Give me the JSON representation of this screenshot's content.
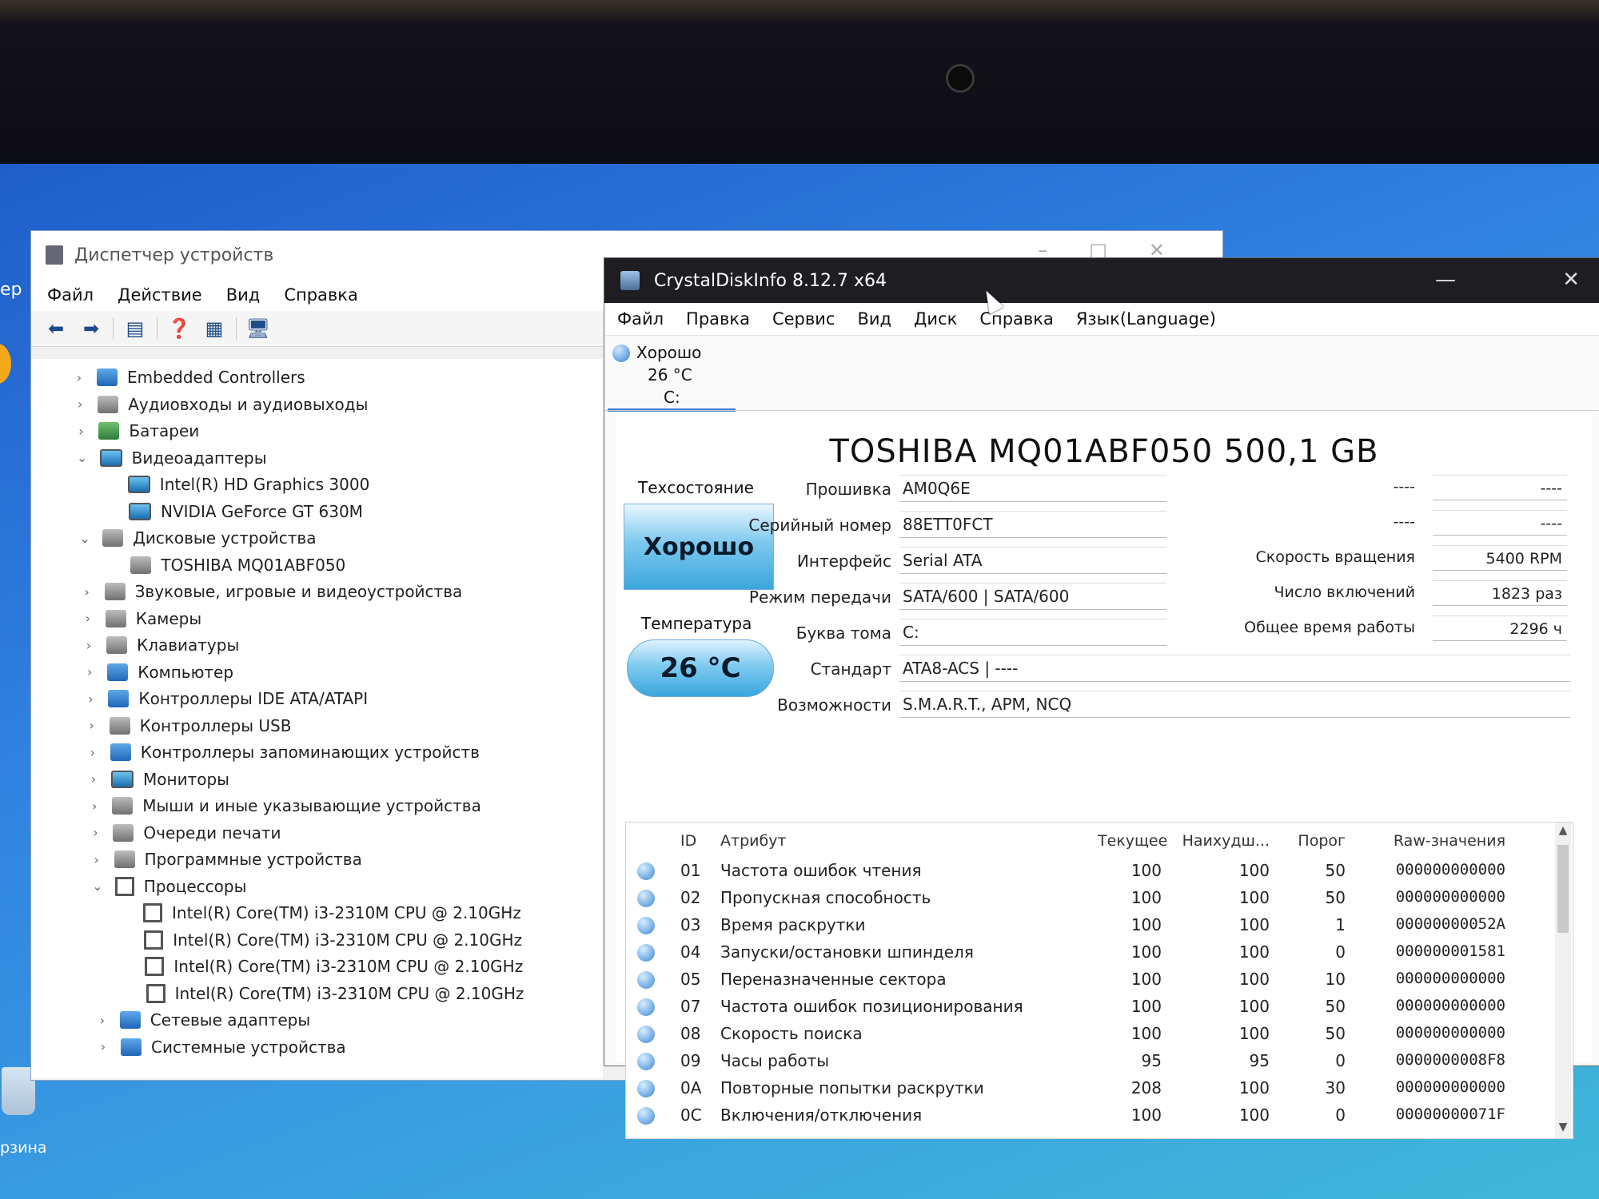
{
  "desktop": {
    "left_text": "ер",
    "recycle_label": "рзина"
  },
  "device_manager": {
    "title": "Диспетчер устройств",
    "menu": [
      "Файл",
      "Действие",
      "Вид",
      "Справка"
    ],
    "toolbar_icons": [
      "back-icon",
      "forward-icon",
      "properties-icon",
      "help-icon",
      "view-icon",
      "monitor-icon"
    ],
    "tree": [
      {
        "label": "Embedded Controllers",
        "level": 0,
        "expanded": false,
        "icon": "controller-icon"
      },
      {
        "label": "Аудиовходы и аудиовыходы",
        "level": 0,
        "expanded": false,
        "icon": "speaker-icon"
      },
      {
        "label": "Батареи",
        "level": 0,
        "expanded": false,
        "icon": "battery-icon"
      },
      {
        "label": "Видеоадаптеры",
        "level": 0,
        "expanded": true,
        "icon": "display-adapter-icon"
      },
      {
        "label": "Intel(R) HD Graphics 3000",
        "level": 1,
        "icon": "display-adapter-icon"
      },
      {
        "label": "NVIDIA GeForce GT 630M",
        "level": 1,
        "icon": "display-adapter-icon"
      },
      {
        "label": "Дисковые устройства",
        "level": 0,
        "expanded": true,
        "icon": "disk-icon"
      },
      {
        "label": "TOSHIBA MQ01ABF050",
        "level": 1,
        "icon": "disk-icon"
      },
      {
        "label": "Звуковые, игровые и видеоустройства",
        "level": 0,
        "expanded": false,
        "icon": "speaker-icon"
      },
      {
        "label": "Камеры",
        "level": 0,
        "expanded": false,
        "icon": "camera-icon"
      },
      {
        "label": "Клавиатуры",
        "level": 0,
        "expanded": false,
        "icon": "keyboard-icon"
      },
      {
        "label": "Компьютер",
        "level": 0,
        "expanded": false,
        "icon": "computer-icon"
      },
      {
        "label": "Контроллеры IDE ATA/ATAPI",
        "level": 0,
        "expanded": false,
        "icon": "controller-icon"
      },
      {
        "label": "Контроллеры USB",
        "level": 0,
        "expanded": false,
        "icon": "usb-icon"
      },
      {
        "label": "Контроллеры запоминающих устройств",
        "level": 0,
        "expanded": false,
        "icon": "storage-controller-icon"
      },
      {
        "label": "Мониторы",
        "level": 0,
        "expanded": false,
        "icon": "monitor-icon"
      },
      {
        "label": "Мыши и иные указывающие устройства",
        "level": 0,
        "expanded": false,
        "icon": "mouse-icon"
      },
      {
        "label": "Очереди печати",
        "level": 0,
        "expanded": false,
        "icon": "printer-icon"
      },
      {
        "label": "Программные устройства",
        "level": 0,
        "expanded": false,
        "icon": "software-device-icon"
      },
      {
        "label": "Процессоры",
        "level": 0,
        "expanded": true,
        "icon": "cpu-icon"
      },
      {
        "label": "Intel(R) Core(TM) i3-2310M CPU @ 2.10GHz",
        "level": 1,
        "icon": "cpu-icon"
      },
      {
        "label": "Intel(R) Core(TM) i3-2310M CPU @ 2.10GHz",
        "level": 1,
        "icon": "cpu-icon"
      },
      {
        "label": "Intel(R) Core(TM) i3-2310M CPU @ 2.10GHz",
        "level": 1,
        "icon": "cpu-icon"
      },
      {
        "label": "Intel(R) Core(TM) i3-2310M CPU @ 2.10GHz",
        "level": 1,
        "icon": "cpu-icon"
      },
      {
        "label": "Сетевые адаптеры",
        "level": 0,
        "expanded": false,
        "icon": "network-adapter-icon"
      },
      {
        "label": "Системные устройства",
        "level": 0,
        "expanded": false,
        "icon": "system-device-icon"
      }
    ]
  },
  "crystaldiskinfo": {
    "title": "CrystalDiskInfo 8.12.7 x64",
    "menu": [
      "Файл",
      "Правка",
      "Сервис",
      "Вид",
      "Диск",
      "Справка",
      "Язык(Language)"
    ],
    "disk_tab": {
      "status": "Хорошо",
      "temp": "26 °C",
      "letter": "C:"
    },
    "model": "TOSHIBA MQ01ABF050 500,1 GB",
    "health_label": "Техсостояние",
    "health_value": "Хорошо",
    "temp_label": "Температура",
    "temp_value": "26 °C",
    "fields": [
      {
        "label": "Прошивка",
        "value": "AM0Q6E"
      },
      {
        "label": "Серийный номер",
        "value": "88ETT0FCT"
      },
      {
        "label": "Интерфейс",
        "value": "Serial ATA"
      },
      {
        "label": "Режим передачи",
        "value": "SATA/600 | SATA/600"
      },
      {
        "label": "Буква тома",
        "value": "C:"
      },
      {
        "label": "Стандарт",
        "value": "ATA8-ACS | ----"
      },
      {
        "label": "Возможности",
        "value": "S.M.A.R.T., APM, NCQ"
      }
    ],
    "right_fields": [
      {
        "label": "----",
        "value": "----"
      },
      {
        "label": "----",
        "value": "----"
      },
      {
        "label": "Скорость вращения",
        "value": "5400 RPM"
      },
      {
        "label": "Число включений",
        "value": "1823 раз"
      },
      {
        "label": "Общее время работы",
        "value": "2296 ч"
      }
    ],
    "smart_headers": {
      "id": "ID",
      "attr": "Атрибут",
      "cur": "Текущее",
      "worst": "Наихудш...",
      "thr": "Порог",
      "raw": "Raw-значения"
    },
    "smart_rows": [
      {
        "id": "01",
        "name": "Частота ошибок чтения",
        "cur": "100",
        "worst": "100",
        "thr": "50",
        "raw": "000000000000"
      },
      {
        "id": "02",
        "name": "Пропускная способность",
        "cur": "100",
        "worst": "100",
        "thr": "50",
        "raw": "000000000000"
      },
      {
        "id": "03",
        "name": "Время раскрутки",
        "cur": "100",
        "worst": "100",
        "thr": "1",
        "raw": "00000000052A"
      },
      {
        "id": "04",
        "name": "Запуски/остановки шпинделя",
        "cur": "100",
        "worst": "100",
        "thr": "0",
        "raw": "000000001581"
      },
      {
        "id": "05",
        "name": "Переназначенные сектора",
        "cur": "100",
        "worst": "100",
        "thr": "10",
        "raw": "000000000000"
      },
      {
        "id": "07",
        "name": "Частота ошибок позиционирования",
        "cur": "100",
        "worst": "100",
        "thr": "50",
        "raw": "000000000000"
      },
      {
        "id": "08",
        "name": "Скорость поиска",
        "cur": "100",
        "worst": "100",
        "thr": "50",
        "raw": "000000000000"
      },
      {
        "id": "09",
        "name": "Часы работы",
        "cur": "95",
        "worst": "95",
        "thr": "0",
        "raw": "0000000008F8"
      },
      {
        "id": "0A",
        "name": "Повторные попытки раскрутки",
        "cur": "208",
        "worst": "100",
        "thr": "30",
        "raw": "000000000000"
      },
      {
        "id": "0C",
        "name": "Включения/отключения",
        "cur": "100",
        "worst": "100",
        "thr": "0",
        "raw": "00000000071F"
      }
    ]
  }
}
